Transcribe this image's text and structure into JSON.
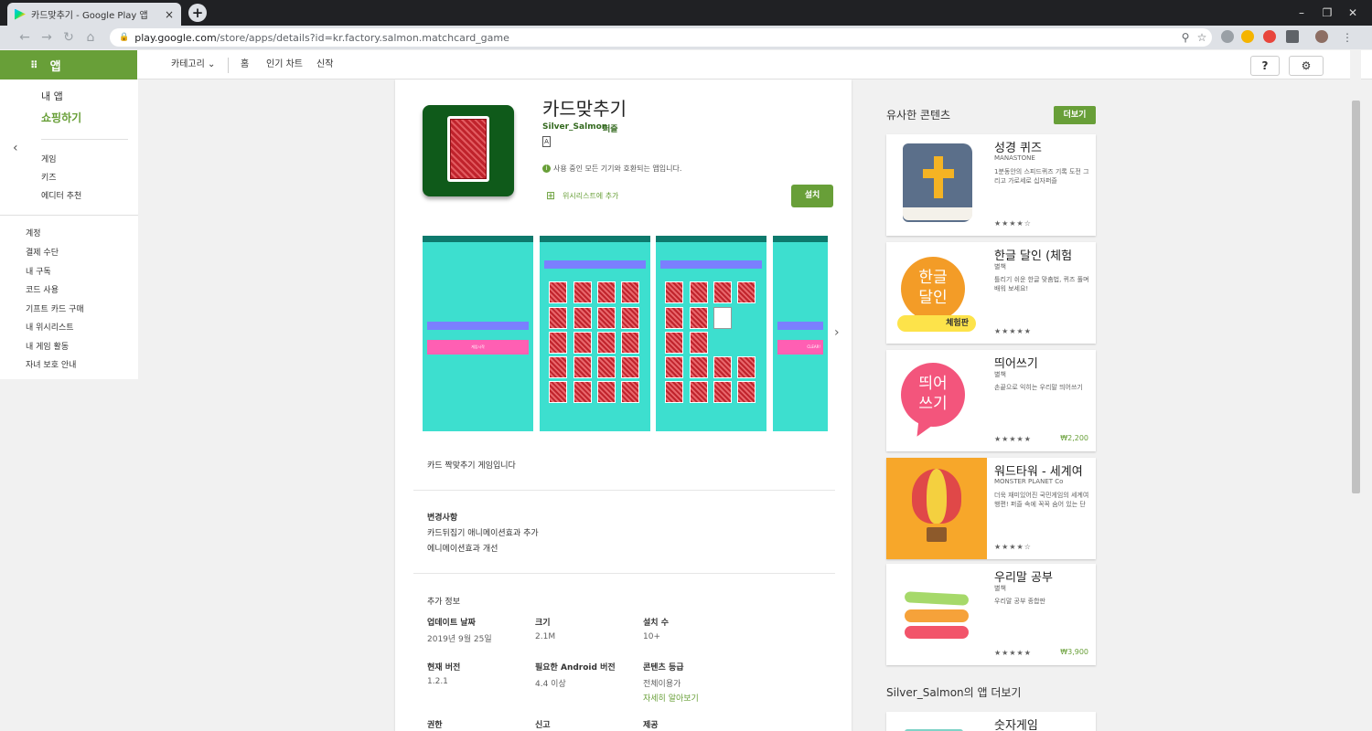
{
  "browser": {
    "tab_title": "카드맞추기 - Google Play 앱",
    "tab_close": "×",
    "new_tab": "+",
    "url_host": "play.google.com",
    "url_path": "/store/apps/details?id=kr.factory.salmon.matchcard_game",
    "win_min": "–",
    "win_restore": "❐",
    "win_close": "✕"
  },
  "store": {
    "brand_icon": "⠿",
    "brand": "앱",
    "nav": {
      "categories": "카테고리 ⌄",
      "home": "홈",
      "top_charts": "인기 차트",
      "new": "신작"
    },
    "help_icon": "?",
    "settings_icon": "⚙"
  },
  "sidebar": {
    "my_apps": "내 앱",
    "shop": "쇼핑하기",
    "games": "게임",
    "kids": "키즈",
    "editors": "에디터 추천",
    "account": [
      "계정",
      "결제 수단",
      "내 구독",
      "코드 사용",
      "기프트 카드 구매",
      "내 위시리스트",
      "내 게임 활동",
      "자녀 보호 안내"
    ]
  },
  "app": {
    "title": "카드맞추기",
    "developer": "Silver_Salmon",
    "category": "퍼즐",
    "compat": "사용 중인 모든 기기와 호환되는 앱입니다.",
    "wishlist": "위시리스트에 추가",
    "install": "설치",
    "screenshot_labels": {
      "start": "게임시작",
      "clear": "CLEAR!"
    },
    "description": "카드 짝맞추기 게임입니다",
    "changes_title": "변경사항",
    "changes": [
      "카드뒤집기 애니메이션효과 추가",
      "에니메이션효과 개선"
    ],
    "info_title": "추가 정보",
    "info": {
      "updated_label": "업데이트 날짜",
      "updated": "2019년 9월 25일",
      "size_label": "크기",
      "size": "2.1M",
      "installs_label": "설치 수",
      "installs": "10+",
      "version_label": "현재 버전",
      "version": "1.2.1",
      "android_label": "필요한 Android 버전",
      "android": "4.4 이상",
      "content_label": "콘텐츠 등급",
      "content": "전체이용가",
      "content_more": "자세히 알아보기",
      "perm_label": "권한",
      "report_label": "신고",
      "offered_label": "제공"
    }
  },
  "similar": {
    "title": "유사한 콘텐츠",
    "more": "더보기",
    "items": [
      {
        "name": "성경 퀴즈",
        "dev": "MANASTONE",
        "desc": "1분동안의 스피드퀴즈 기록 도전 그리고 가로세로 십자퍼즐",
        "stars": "★★★★☆",
        "price": ""
      },
      {
        "name": "한글 달인 (체험",
        "dev": "별책",
        "desc": "틀리기 쉬운 한글 맞춤법, 퀴즈 풀며 배워 보세요!",
        "stars": "★★★★★",
        "price": ""
      },
      {
        "name": "띄어쓰기",
        "dev": "별책",
        "desc": "손끝으로 익히는 우리말 띄어쓰기",
        "stars": "★★★★★",
        "price": "₩2,200"
      },
      {
        "name": "워드타워 - 세계여",
        "dev": "MONSTER PLANET Co",
        "desc": "더욱 재미있어진 국민게임의 세계여행편! 퍼즐 속에 꼭꼭 숨어 있는 단",
        "stars": "★★★★☆",
        "price": ""
      },
      {
        "name": "우리말 공부",
        "dev": "별책",
        "desc": "우리말 공부 종합판",
        "stars": "★★★★★",
        "price": "₩3,900"
      }
    ],
    "icon_text": {
      "hangul_top": "한글",
      "hangul_bottom": "달인",
      "hangul_tag": "체험판",
      "spacing_top": "띄어",
      "spacing_bottom": "쓰기"
    }
  },
  "more_apps": "Silver_Salmon의 앱 더보기",
  "more_app_first": "숫자게임"
}
